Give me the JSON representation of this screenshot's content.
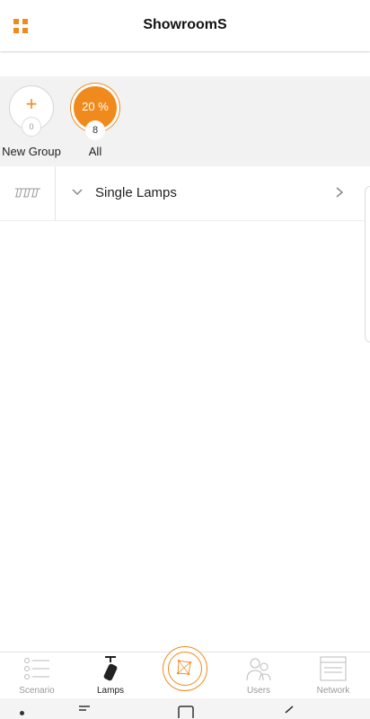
{
  "header": {
    "title": "ShowroomS",
    "menu_icon": "grid-menu-icon"
  },
  "groups": [
    {
      "id": "new",
      "label": "New Group",
      "count": "0",
      "icon": "plus-icon"
    },
    {
      "id": "all",
      "label": "All",
      "count": "8",
      "percent": "20 %"
    }
  ],
  "lamps_row": {
    "label": "Single Lamps",
    "icon": "lamp-group-icon"
  },
  "bottom_nav": [
    {
      "label": "Scenario",
      "icon": "list-icon",
      "active": false
    },
    {
      "label": "Lamps",
      "icon": "spotlight-icon",
      "active": true
    },
    {
      "label": "",
      "icon": "hub-icon",
      "active": false
    },
    {
      "label": "Users",
      "icon": "users-icon",
      "active": false
    },
    {
      "label": "Network",
      "icon": "network-icon",
      "active": false
    }
  ],
  "colors": {
    "accent": "#f08a1c",
    "band": "#f2f2f2",
    "text": "#222222",
    "muted": "#9a9a9a"
  }
}
